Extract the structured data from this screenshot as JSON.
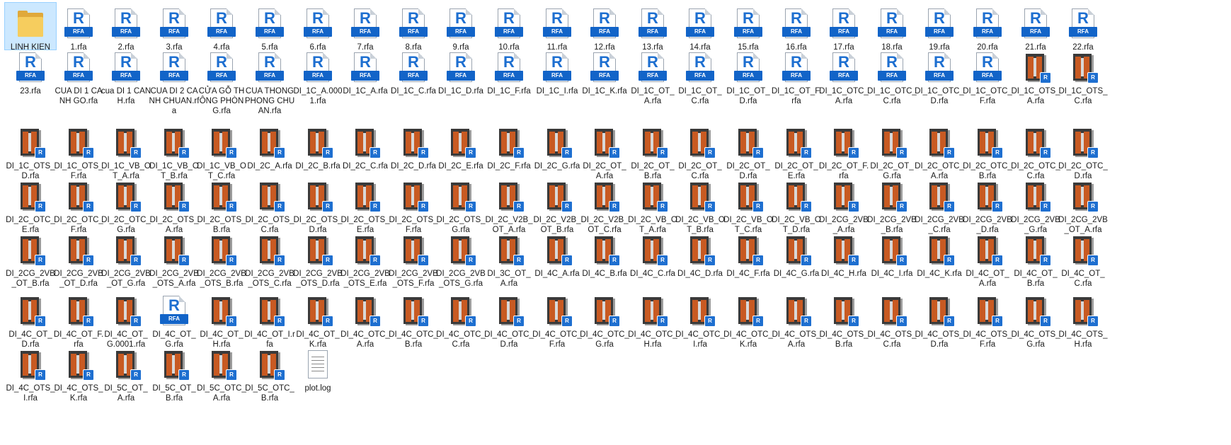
{
  "view": {
    "columns": 23,
    "badge_letter": "R",
    "rfa_band_text": "RFA",
    "items": [
      {
        "name": "LINH KIEN",
        "icon": "folder-icon",
        "selected": true
      },
      {
        "name": "1.rfa",
        "icon": "rfa-icon"
      },
      {
        "name": "2.rfa",
        "icon": "rfa-icon"
      },
      {
        "name": "3.rfa",
        "icon": "rfa-icon"
      },
      {
        "name": "4.rfa",
        "icon": "rfa-icon"
      },
      {
        "name": "5.rfa",
        "icon": "rfa-icon"
      },
      {
        "name": "6.rfa",
        "icon": "rfa-icon"
      },
      {
        "name": "7.rfa",
        "icon": "rfa-icon"
      },
      {
        "name": "8.rfa",
        "icon": "rfa-icon"
      },
      {
        "name": "9.rfa",
        "icon": "rfa-icon"
      },
      {
        "name": "10.rfa",
        "icon": "rfa-icon"
      },
      {
        "name": "11.rfa",
        "icon": "rfa-icon"
      },
      {
        "name": "12.rfa",
        "icon": "rfa-icon"
      },
      {
        "name": "13.rfa",
        "icon": "rfa-icon"
      },
      {
        "name": "14.rfa",
        "icon": "rfa-icon"
      },
      {
        "name": "15.rfa",
        "icon": "rfa-icon"
      },
      {
        "name": "16.rfa",
        "icon": "rfa-icon"
      },
      {
        "name": "17.rfa",
        "icon": "rfa-icon"
      },
      {
        "name": "18.rfa",
        "icon": "rfa-icon"
      },
      {
        "name": "19.rfa",
        "icon": "rfa-icon"
      },
      {
        "name": "20.rfa",
        "icon": "rfa-icon"
      },
      {
        "name": "21.rfa",
        "icon": "rfa-icon"
      },
      {
        "name": "22.rfa",
        "icon": "rfa-icon"
      },
      {
        "name": "23.rfa",
        "icon": "rfa-icon"
      },
      {
        "name": "CUA DI 1 CANH GO.rfa",
        "icon": "rfa-icon"
      },
      {
        "name": "cua DI 1 CANH.rfa",
        "icon": "rfa-icon"
      },
      {
        "name": "CUA DI 2 CANH CHUAN.rfa",
        "icon": "rfa-icon"
      },
      {
        "name": "CỬA GỖ THÔNG PHÒNG.rfa",
        "icon": "rfa-icon"
      },
      {
        "name": "CUA THONG PHONG CHUAN.rfa",
        "icon": "rfa-icon"
      },
      {
        "name": "DI_1C_A.0001.rfa",
        "icon": "rfa-icon"
      },
      {
        "name": "DI_1C_A.rfa",
        "icon": "rfa-icon"
      },
      {
        "name": "DI_1C_C.rfa",
        "icon": "rfa-icon"
      },
      {
        "name": "DI_1C_D.rfa",
        "icon": "rfa-icon"
      },
      {
        "name": "DI_1C_F.rfa",
        "icon": "rfa-icon"
      },
      {
        "name": "DI_1C_I.rfa",
        "icon": "rfa-icon"
      },
      {
        "name": "DI_1C_K.rfa",
        "icon": "rfa-icon"
      },
      {
        "name": "DI_1C_OT_A.rfa",
        "icon": "rfa-icon"
      },
      {
        "name": "DI_1C_OT_C.rfa",
        "icon": "rfa-icon"
      },
      {
        "name": "DI_1C_OT_D.rfa",
        "icon": "rfa-icon"
      },
      {
        "name": "DI_1C_OT_F.rfa",
        "icon": "rfa-icon"
      },
      {
        "name": "DI_1C_OTC_A.rfa",
        "icon": "rfa-icon"
      },
      {
        "name": "DI_1C_OTC_C.rfa",
        "icon": "rfa-icon"
      },
      {
        "name": "DI_1C_OTC_D.rfa",
        "icon": "rfa-icon"
      },
      {
        "name": "DI_1C_OTC_F.rfa",
        "icon": "rfa-icon"
      },
      {
        "name": "DI_1C_OTS_A.rfa",
        "icon": "door-thumbnail-icon"
      },
      {
        "name": "DI_1C_OTS_C.rfa",
        "icon": "door-thumbnail-icon"
      },
      {
        "name": "DI_1C_OTS_D.rfa",
        "icon": "door-thumbnail-icon"
      },
      {
        "name": "DI_1C_OTS_F.rfa",
        "icon": "door-thumbnail-icon"
      },
      {
        "name": "DI_1C_VB_OT_A.rfa",
        "icon": "door-thumbnail-icon"
      },
      {
        "name": "DI_1C_VB_OT_B.rfa",
        "icon": "door-thumbnail-icon"
      },
      {
        "name": "DI_1C_VB_OT_C.rfa",
        "icon": "door-thumbnail-icon"
      },
      {
        "name": "DI_2C_A.rfa",
        "icon": "door-thumbnail-icon"
      },
      {
        "name": "DI_2C_B.rfa",
        "icon": "door-thumbnail-icon"
      },
      {
        "name": "DI_2C_C.rfa",
        "icon": "door-thumbnail-icon"
      },
      {
        "name": "DI_2C_D.rfa",
        "icon": "door-thumbnail-icon"
      },
      {
        "name": "DI_2C_E.rfa",
        "icon": "door-thumbnail-icon"
      },
      {
        "name": "DI_2C_F.rfa",
        "icon": "door-thumbnail-icon"
      },
      {
        "name": "DI_2C_G.rfa",
        "icon": "door-thumbnail-icon"
      },
      {
        "name": "DI_2C_OT_A.rfa",
        "icon": "door-thumbnail-icon"
      },
      {
        "name": "DI_2C_OT_B.rfa",
        "icon": "door-thumbnail-icon"
      },
      {
        "name": "DI_2C_OT_C.rfa",
        "icon": "door-thumbnail-icon"
      },
      {
        "name": "DI_2C_OT_D.rfa",
        "icon": "door-thumbnail-icon"
      },
      {
        "name": "DI_2C_OT_E.rfa",
        "icon": "door-thumbnail-icon"
      },
      {
        "name": "DI_2C_OT_F.rfa",
        "icon": "door-thumbnail-icon"
      },
      {
        "name": "DI_2C_OT_G.rfa",
        "icon": "door-thumbnail-icon"
      },
      {
        "name": "DI_2C_OTC_A.rfa",
        "icon": "door-thumbnail-icon"
      },
      {
        "name": "DI_2C_OTC_B.rfa",
        "icon": "door-thumbnail-icon"
      },
      {
        "name": "DI_2C_OTC_C.rfa",
        "icon": "door-thumbnail-icon"
      },
      {
        "name": "DI_2C_OTC_D.rfa",
        "icon": "door-thumbnail-icon"
      },
      {
        "name": "DI_2C_OTC_E.rfa",
        "icon": "door-thumbnail-icon"
      },
      {
        "name": "DI_2C_OTC_F.rfa",
        "icon": "door-thumbnail-icon"
      },
      {
        "name": "DI_2C_OTC_G.rfa",
        "icon": "door-thumbnail-icon"
      },
      {
        "name": "DI_2C_OTS_A.rfa",
        "icon": "door-thumbnail-icon"
      },
      {
        "name": "DI_2C_OTS_B.rfa",
        "icon": "door-thumbnail-icon"
      },
      {
        "name": "DI_2C_OTS_C.rfa",
        "icon": "door-thumbnail-icon"
      },
      {
        "name": "DI_2C_OTS_D.rfa",
        "icon": "door-thumbnail-icon"
      },
      {
        "name": "DI_2C_OTS_E.rfa",
        "icon": "door-thumbnail-icon"
      },
      {
        "name": "DI_2C_OTS_F.rfa",
        "icon": "door-thumbnail-icon"
      },
      {
        "name": "DI_2C_OTS_G.rfa",
        "icon": "door-thumbnail-icon"
      },
      {
        "name": "DI_2C_V2B_OT_A.rfa",
        "icon": "door-thumbnail-icon"
      },
      {
        "name": "DI_2C_V2B_OT_B.rfa",
        "icon": "door-thumbnail-icon"
      },
      {
        "name": "DI_2C_V2B_OT_C.rfa",
        "icon": "door-thumbnail-icon"
      },
      {
        "name": "DI_2C_VB_OT_A.rfa",
        "icon": "door-thumbnail-icon"
      },
      {
        "name": "DI_2C_VB_OT_B.rfa",
        "icon": "door-thumbnail-icon"
      },
      {
        "name": "DI_2C_VB_OT_C.rfa",
        "icon": "door-thumbnail-icon"
      },
      {
        "name": "DI_2C_VB_OT_D.rfa",
        "icon": "door-thumbnail-icon"
      },
      {
        "name": "DI_2CG_2VB_A.rfa",
        "icon": "door-thumbnail-icon"
      },
      {
        "name": "DI_2CG_2VB_B.rfa",
        "icon": "door-thumbnail-icon"
      },
      {
        "name": "DI_2CG_2VB_C.rfa",
        "icon": "door-thumbnail-icon"
      },
      {
        "name": "DI_2CG_2VB_D.rfa",
        "icon": "door-thumbnail-icon"
      },
      {
        "name": "DI_2CG_2VB_G.rfa",
        "icon": "door-thumbnail-icon"
      },
      {
        "name": "DI_2CG_2VB_OT_A.rfa",
        "icon": "door-thumbnail-icon"
      },
      {
        "name": "DI_2CG_2VB_OT_B.rfa",
        "icon": "door-thumbnail-icon"
      },
      {
        "name": "DI_2CG_2VB_OT_D.rfa",
        "icon": "door-thumbnail-icon"
      },
      {
        "name": "DI_2CG_2VB_OT_G.rfa",
        "icon": "door-thumbnail-icon"
      },
      {
        "name": "DI_2CG_2VB_OTS_A.rfa",
        "icon": "door-thumbnail-icon"
      },
      {
        "name": "DI_2CG_2VB_OTS_B.rfa",
        "icon": "door-thumbnail-icon"
      },
      {
        "name": "DI_2CG_2VB_OTS_C.rfa",
        "icon": "door-thumbnail-icon"
      },
      {
        "name": "DI_2CG_2VB_OTS_D.rfa",
        "icon": "door-thumbnail-icon"
      },
      {
        "name": "DI_2CG_2VB_OTS_E.rfa",
        "icon": "door-thumbnail-icon"
      },
      {
        "name": "DI_2CG_2VB_OTS_F.rfa",
        "icon": "door-thumbnail-icon"
      },
      {
        "name": "DI_2CG_2VB_OTS_G.rfa",
        "icon": "door-thumbnail-icon"
      },
      {
        "name": "DI_3C_OT_A.rfa",
        "icon": "door-thumbnail-icon"
      },
      {
        "name": "DI_4C_A.rfa",
        "icon": "door-thumbnail-icon"
      },
      {
        "name": "DI_4C_B.rfa",
        "icon": "door-thumbnail-icon"
      },
      {
        "name": "DI_4C_C.rfa",
        "icon": "door-thumbnail-icon"
      },
      {
        "name": "DI_4C_D.rfa",
        "icon": "door-thumbnail-icon"
      },
      {
        "name": "DI_4C_F.rfa",
        "icon": "door-thumbnail-icon"
      },
      {
        "name": "DI_4C_G.rfa",
        "icon": "door-thumbnail-icon"
      },
      {
        "name": "DI_4C_H.rfa",
        "icon": "door-thumbnail-icon"
      },
      {
        "name": "DI_4C_I.rfa",
        "icon": "door-thumbnail-icon"
      },
      {
        "name": "DI_4C_K.rfa",
        "icon": "door-thumbnail-icon"
      },
      {
        "name": "DI_4C_OT_A.rfa",
        "icon": "door-thumbnail-icon"
      },
      {
        "name": "DI_4C_OT_B.rfa",
        "icon": "door-thumbnail-icon"
      },
      {
        "name": "DI_4C_OT_C.rfa",
        "icon": "door-thumbnail-icon"
      },
      {
        "name": "DI_4C_OT_D.rfa",
        "icon": "door-thumbnail-icon"
      },
      {
        "name": "DI_4C_OT_F.rfa",
        "icon": "door-thumbnail-icon"
      },
      {
        "name": "DI_4C_OT_G.0001.rfa",
        "icon": "door-thumbnail-icon"
      },
      {
        "name": "DI_4C_OT_G.rfa",
        "icon": "rfa-icon"
      },
      {
        "name": "DI_4C_OT_H.rfa",
        "icon": "door-thumbnail-icon"
      },
      {
        "name": "DI_4C_OT_I.rfa",
        "icon": "door-thumbnail-icon"
      },
      {
        "name": "DI_4C_OT_K.rfa",
        "icon": "door-thumbnail-icon"
      },
      {
        "name": "DI_4C_OTC_A.rfa",
        "icon": "door-thumbnail-icon"
      },
      {
        "name": "DI_4C_OTC_B.rfa",
        "icon": "door-thumbnail-icon"
      },
      {
        "name": "DI_4C_OTC_C.rfa",
        "icon": "door-thumbnail-icon"
      },
      {
        "name": "DI_4C_OTC_D.rfa",
        "icon": "door-thumbnail-icon"
      },
      {
        "name": "DI_4C_OTC_F.rfa",
        "icon": "door-thumbnail-icon"
      },
      {
        "name": "DI_4C_OTC_G.rfa",
        "icon": "door-thumbnail-icon"
      },
      {
        "name": "DI_4C_OTC_H.rfa",
        "icon": "door-thumbnail-icon"
      },
      {
        "name": "DI_4C_OTC_I.rfa",
        "icon": "door-thumbnail-icon"
      },
      {
        "name": "DI_4C_OTC_K.rfa",
        "icon": "door-thumbnail-icon"
      },
      {
        "name": "DI_4C_OTS_A.rfa",
        "icon": "door-thumbnail-icon"
      },
      {
        "name": "DI_4C_OTS_B.rfa",
        "icon": "door-thumbnail-icon"
      },
      {
        "name": "DI_4C_OTS_C.rfa",
        "icon": "door-thumbnail-icon"
      },
      {
        "name": "DI_4C_OTS_D.rfa",
        "icon": "door-thumbnail-icon"
      },
      {
        "name": "DI_4C_OTS_F.rfa",
        "icon": "door-thumbnail-icon"
      },
      {
        "name": "DI_4C_OTS_G.rfa",
        "icon": "door-thumbnail-icon"
      },
      {
        "name": "DI_4C_OTS_H.rfa",
        "icon": "door-thumbnail-icon"
      },
      {
        "name": "DI_4C_OTS_I.rfa",
        "icon": "door-thumbnail-icon"
      },
      {
        "name": "DI_4C_OTS_K.rfa",
        "icon": "door-thumbnail-icon"
      },
      {
        "name": "DI_5C_OT_A.rfa",
        "icon": "door-thumbnail-icon"
      },
      {
        "name": "DI_5C_OT_B.rfa",
        "icon": "door-thumbnail-icon"
      },
      {
        "name": "DI_5C_OTC_A.rfa",
        "icon": "door-thumbnail-icon"
      },
      {
        "name": "DI_5C_OTC_B.rfa",
        "icon": "door-thumbnail-icon"
      },
      {
        "name": "plot.log",
        "icon": "text-file-icon"
      }
    ]
  },
  "colors": {
    "selection_bg": "#cce8ff",
    "revit_blue": "#1264c8",
    "door_wood": "#c85a22",
    "folder": "#f6cd5e"
  }
}
